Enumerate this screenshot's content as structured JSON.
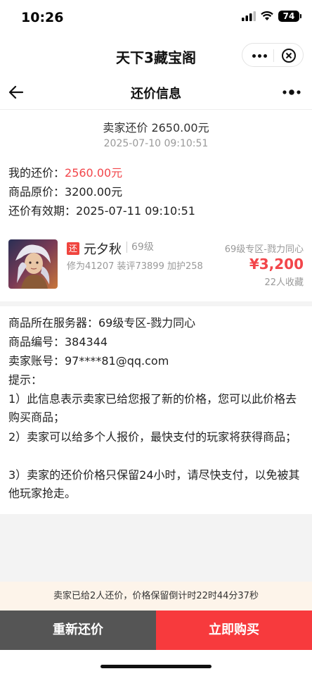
{
  "status_bar": {
    "time": "10:26",
    "battery": "74"
  },
  "app_header": {
    "title": "天下3藏宝阁"
  },
  "nav": {
    "title": "还价信息"
  },
  "offer": {
    "title": "卖家还价 2650.00元",
    "time": "2025-07-10 09:10:51"
  },
  "price_info": {
    "my_offer_label": "我的还价：",
    "my_offer_value": "2560.00元",
    "original_label": "商品原价：",
    "original_value": "3200.00元",
    "valid_label": "还价有效期：",
    "valid_value": "2025-07-11 09:10:51"
  },
  "product": {
    "tag": "还",
    "name": "元夕秋",
    "level": "69级",
    "stats": "修为41207 装评73899 加护258",
    "server": "69级专区-戮力同心",
    "price": "¥3,200",
    "favorites": "22人收藏"
  },
  "details": {
    "server": "商品所在服务器：69级专区-戮力同心",
    "item_no": "商品编号：384344",
    "seller_account": "卖家账号：97****81@qq.com",
    "tips_title": "提示：",
    "tip1": "1）此信息表示卖家已给您报了新的价格，您可以此价格去购买商品；",
    "tip2": "2）卖家可以给多个人报价，最快支付的玩家将获得商品；",
    "tip3": "3）卖家的还价价格只保留24小时，请尽快支付，以免被其他玩家抢走。"
  },
  "notice": "卖家已给2人还价，价格保留倒计时22时44分37秒",
  "buttons": {
    "reoffer": "重新还价",
    "buy_now": "立即购买"
  },
  "colors": {
    "accent": "#f73a3d",
    "price_red": "#f2464b",
    "dark_button": "#555555"
  }
}
